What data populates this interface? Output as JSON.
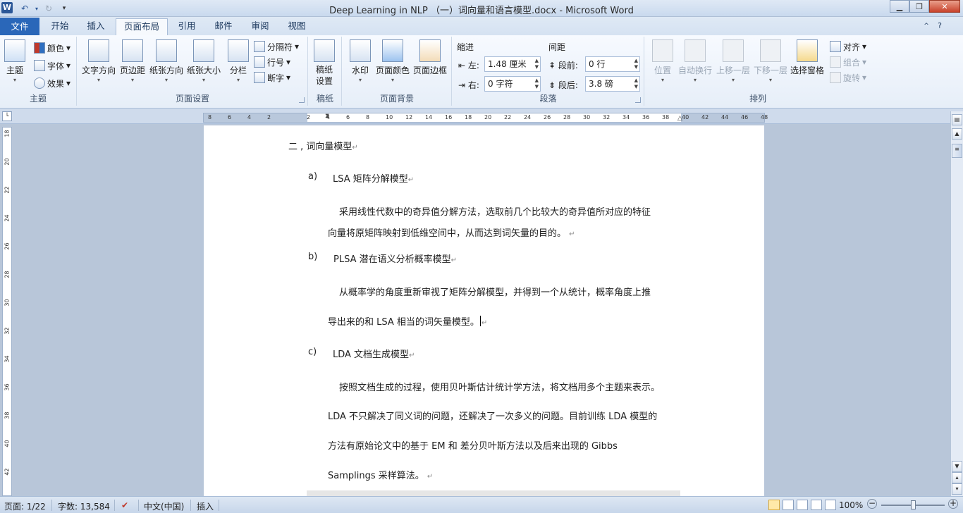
{
  "window": {
    "title": "Deep Learning in NLP （一）词向量和语言模型.docx - Microsoft Word",
    "logo": "W"
  },
  "tabs": [
    {
      "label": "文件"
    },
    {
      "label": "开始"
    },
    {
      "label": "插入"
    },
    {
      "label": "页面布局"
    },
    {
      "label": "引用"
    },
    {
      "label": "邮件"
    },
    {
      "label": "审阅"
    },
    {
      "label": "视图"
    }
  ],
  "ribbon": {
    "theme": {
      "label": "主题",
      "main": "主题",
      "colors": "颜色",
      "fonts": "字体",
      "effects": "效果"
    },
    "pagesetup": {
      "label": "页面设置",
      "text_direction": "文字方向",
      "margins": "页边距",
      "orientation": "纸张方向",
      "size": "纸张大小",
      "columns": "分栏",
      "breaks": "分隔符",
      "line_numbers": "行号",
      "hyphenation": "断字"
    },
    "manuscript": {
      "label": "稿纸",
      "setup": "稿纸\n设置"
    },
    "background": {
      "label": "页面背景",
      "watermark": "水印",
      "page_color": "页面颜色",
      "page_border": "页面边框"
    },
    "paragraph": {
      "label": "段落",
      "indent_label": "缩进",
      "spacing_label": "间距",
      "left": "左:",
      "left_value": "1.48 厘米",
      "right": "右:",
      "right_value": "0 字符",
      "before": "段前:",
      "before_value": "0 行",
      "after": "段后:",
      "after_value": "3.8 磅"
    },
    "arrange": {
      "label": "排列",
      "position": "位置",
      "wrap": "自动换行",
      "forward": "上移一层",
      "backward": "下移一层",
      "selection_pane": "选择窗格",
      "align": "对齐",
      "group": "组合",
      "rotate": "旋转"
    }
  },
  "ruler": {
    "ticks": [
      "8",
      "6",
      "4",
      "2",
      "",
      "2",
      "4",
      "6",
      "8",
      "10",
      "12",
      "14",
      "16",
      "18",
      "20",
      "22",
      "24",
      "26",
      "28",
      "30",
      "32",
      "34",
      "36",
      "38",
      "40",
      "42",
      "44",
      "46",
      "48"
    ]
  },
  "vruler": {
    "ticks": [
      "18",
      "20",
      "22",
      "24",
      "26",
      "28",
      "30",
      "32",
      "34",
      "36",
      "38",
      "40",
      "42"
    ]
  },
  "document": {
    "heading": "二 , 词向量模型",
    "a_marker": "a)",
    "a_title": "LSA 矩阵分解模型",
    "a_line1": "采用线性代数中的奇异值分解方法，选取前几个比较大的奇异值所对应的特征",
    "a_line2": "向量将原矩阵映射到低维空间中，从而达到词矢量的目的。",
    "b_marker": "b)",
    "b_title": "PLSA 潜在语义分析概率模型",
    "b_line1": "从概率学的角度重新审视了矩阵分解模型，并得到一个从统计，概率角度上推",
    "b_line2": "导出来的和 LSA 相当的词矢量模型。",
    "c_marker": "c)",
    "c_title": "LDA 文档生成模型",
    "c_line1": "按照文档生成的过程，使用贝叶斯估计统计学方法，将文档用多个主题来表示。",
    "c_line2": "LDA 不只解决了同义词的问题，还解决了一次多义的问题。目前训练 LDA 模型的",
    "c_line3": "方法有原始论文中的基于 EM 和 差分贝叶斯方法以及后来出现的 Gibbs",
    "c_line4": "Samplings 采样算法。",
    "para_mark": "↵"
  },
  "status": {
    "page": "页面: 1/22",
    "words": "字数: 13,584",
    "language": "中文(中国)",
    "mode": "插入",
    "zoom": "100%"
  }
}
